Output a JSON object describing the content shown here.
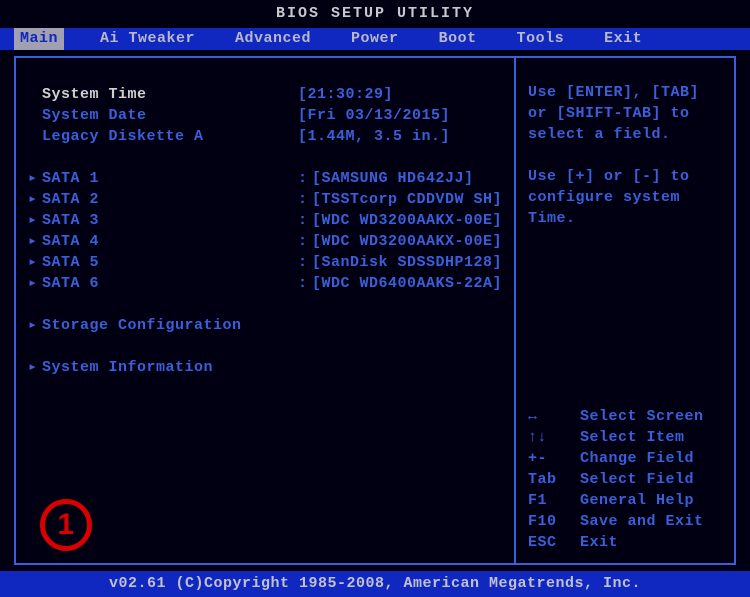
{
  "title": "BIOS SETUP UTILITY",
  "tabs": [
    "Main",
    "Ai Tweaker",
    "Advanced",
    "Power",
    "Boot",
    "Tools",
    "Exit"
  ],
  "active_tab": 0,
  "fields": {
    "time": {
      "label": "System Time",
      "value": "[21:30:29]",
      "highlight": true
    },
    "date": {
      "label": "System Date",
      "value": "[Fri 03/13/2015]"
    },
    "legacy": {
      "label": "Legacy Diskette A",
      "value": "[1.44M, 3.5 in.]"
    }
  },
  "sata": [
    {
      "label": "SATA 1",
      "value": "[SAMSUNG HD642JJ]"
    },
    {
      "label": "SATA 2",
      "value": "[TSSTcorp CDDVDW SH]"
    },
    {
      "label": "SATA 3",
      "value": "[WDC WD3200AAKX-00E]"
    },
    {
      "label": "SATA 4",
      "value": "[WDC WD3200AAKX-00E]"
    },
    {
      "label": "SATA 5",
      "value": "[SanDisk SDSSDHP128]"
    },
    {
      "label": "SATA 6",
      "value": "[WDC WD6400AAKS-22A]"
    }
  ],
  "submenus": {
    "storage": "Storage Configuration",
    "sysinfo": "System Information"
  },
  "help": {
    "line1": "Use [ENTER], [TAB]",
    "line2": "or [SHIFT-TAB] to",
    "line3": "select a field.",
    "line4": "Use [+] or [-] to",
    "line5": "configure system Time."
  },
  "keys": [
    {
      "k": "↔",
      "d": "Select Screen"
    },
    {
      "k": "↑↓",
      "d": "Select Item"
    },
    {
      "k": "+-",
      "d": "Change Field"
    },
    {
      "k": "Tab",
      "d": "Select Field"
    },
    {
      "k": "F1",
      "d": "General Help"
    },
    {
      "k": "F10",
      "d": "Save and Exit"
    },
    {
      "k": "ESC",
      "d": "Exit"
    }
  ],
  "footer": "v02.61 (C)Copyright 1985-2008, American Megatrends, Inc.",
  "annotation": "1"
}
